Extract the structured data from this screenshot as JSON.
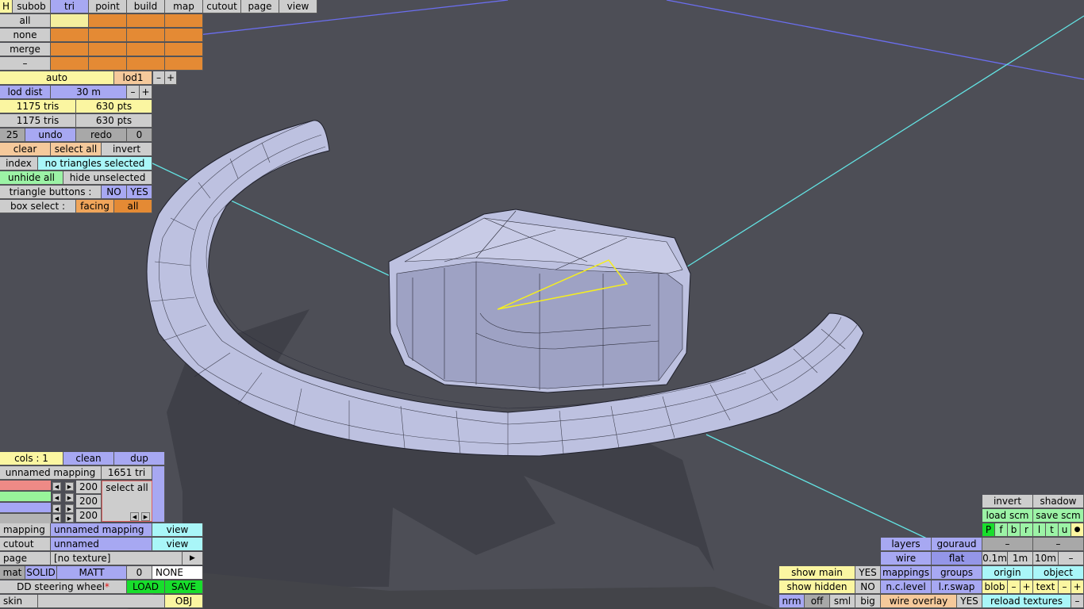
{
  "menu": {
    "h": "H",
    "tabs": [
      "subob",
      "tri",
      "point",
      "build",
      "map",
      "cutout",
      "page",
      "view"
    ],
    "active_tab": "tri"
  },
  "select_panel": {
    "all": "all",
    "none": "none",
    "merge": "merge",
    "minus": "–"
  },
  "lod": {
    "auto": "auto",
    "lod1": "lod1",
    "minus": "–",
    "plus": "+",
    "lod_dist_label": "lod dist",
    "lod_dist_value": "30 m",
    "tris1": "1175 tris",
    "pts1": "630 pts",
    "tris2": "1175 tris",
    "pts2": "630 pts"
  },
  "history": {
    "count": "25",
    "undo": "undo",
    "redo": "redo",
    "redo_count": "0"
  },
  "selection": {
    "clear": "clear",
    "select_all": "select all",
    "invert": "invert",
    "index": "index",
    "status": "no triangles selected",
    "unhide_all": "unhide all",
    "hide_unselected": "hide unselected",
    "triangle_buttons_label": "triangle buttons :",
    "no": "NO",
    "yes": "YES",
    "box_select_label": "box select :",
    "facing": "facing",
    "all": "all"
  },
  "mapping_panel": {
    "cols": "cols : 1",
    "clean": "clean",
    "dup": "dup",
    "mapping_name": "unnamed mapping",
    "tri_count": "1651 tri",
    "v1": "200",
    "v2": "200",
    "v3": "200",
    "select_all": "select all",
    "mapping_label": "mapping",
    "mapping_value": "unnamed mapping",
    "view1": "view",
    "cutout_label": "cutout",
    "cutout_value": "unnamed",
    "view2": "view",
    "page_label": "page",
    "page_value": "[no texture]",
    "page_arrow": "▶",
    "mat": "mat",
    "solid": "SOLID",
    "matt": "MATT",
    "mat_index": "0",
    "none": "NONE",
    "model_name": "DD steering wheel",
    "load": "LOAD",
    "save": "SAVE",
    "skin": "skin",
    "obj": "OBJ"
  },
  "view_panel": {
    "invert": "invert",
    "shadow": "shadow",
    "load_scm": "load scm",
    "save_scm": "save scm",
    "letters": [
      "P",
      "f",
      "b",
      "r",
      "l",
      "t",
      "u"
    ],
    "dot": "●",
    "layers": "layers",
    "gouraud": "gouraud",
    "dash1": "–",
    "dash2": "–",
    "wire": "wire",
    "flat": "flat",
    "m01": "0.1m",
    "m1": "1m",
    "m10": "10m",
    "dash3": "–",
    "show_main": "show main",
    "show_main_val": "YES",
    "mappings": "mappings",
    "groups": "groups",
    "origin": "origin",
    "object": "object",
    "show_hidden": "show hidden",
    "show_hidden_val": "NO",
    "nc_level": "n.c.level",
    "lr_swap": "l.r.swap",
    "blob": "blob",
    "blob_minus": "–",
    "blob_plus": "+",
    "text": "text",
    "text_minus": "–",
    "text_plus": "+",
    "nrm": "nrm",
    "off": "off",
    "sml": "sml",
    "big": "big",
    "wire_overlay": "wire overlay",
    "wire_overlay_val": "YES",
    "reload_textures": "reload textures",
    "reload_minus": "–"
  },
  "colors": {
    "background": "#4d4e56",
    "mesh": "#bdc1e0",
    "selection": "#f5ee20",
    "axis": "#63e3e3"
  }
}
